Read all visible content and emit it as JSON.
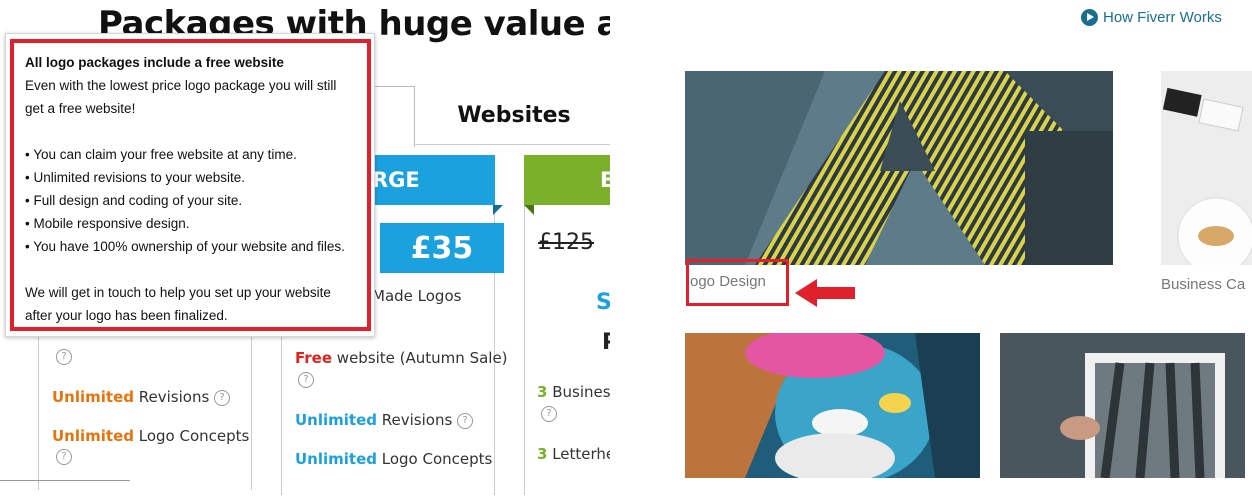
{
  "page": {
    "heading": "Packages with huge value and"
  },
  "tabs": {
    "websites": "Websites"
  },
  "packages": {
    "large_banner": "RGE",
    "right_banner": "E",
    "price": "£35",
    "old_price": "£125",
    "right_fragment_s": "S",
    "right_fragment_p": "P"
  },
  "left_card_features": [
    {
      "hl": "Unlimited",
      "rest": " Revisions"
    },
    {
      "hl": "Unlimited",
      "rest": " Logo Concepts"
    }
  ],
  "mid_card_features": {
    "made_logos": "Made Logos",
    "free_hl": "Free",
    "free_rest": " website (Autumn Sale)",
    "rev_hl": "Unlimited",
    "rev_rest": " Revisions",
    "con_hl": "Unlimited",
    "con_rest": " Logo Concepts"
  },
  "right_card_features": {
    "biz_hl": "3",
    "biz_rest": " Business",
    "letter_hl": "3",
    "letter_rest": " Letterhea"
  },
  "tooltip": {
    "title": "All logo packages include a free website",
    "intro_line1": "Even with the lowest price logo package you will still",
    "intro_line2": "get a free website!",
    "bullets": [
      "• You can claim your free website at any time.",
      "• Unlimited revisions to your website.",
      "• Full design and coding of your site.",
      "• Mobile responsive design.",
      "• You have 100% ownership of your website and files."
    ],
    "outro_line1": "We will get in touch to help you set up your website",
    "outro_line2": "after your logo has been finalized."
  },
  "right_panel": {
    "how_link": "How Fiverr Works",
    "captions": {
      "logo": "ogo Design",
      "biz": "Business Ca"
    }
  },
  "help_icon_glyph": "?",
  "colors": {
    "brand_blue": "#1ba1dd",
    "brand_green": "#7ab02a",
    "highlight_orange": "#e8730c",
    "highlight_red": "#e0211c",
    "annotation_red": "#e0202a",
    "link_blue": "#1a6f8f"
  },
  "icons": {
    "help": "question-circle-icon",
    "play": "play-circle-icon",
    "arrow": "left-arrow-icon"
  }
}
